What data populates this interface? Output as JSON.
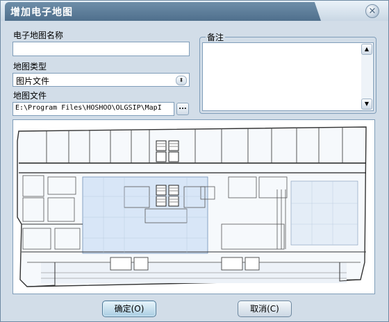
{
  "window": {
    "title": "增加电子地图"
  },
  "form": {
    "map_name_label": "电子地图名称",
    "map_name_value": "",
    "map_type_label": "地图类型",
    "map_type_value": "图片文件",
    "map_file_label": "地图文件",
    "map_file_value": "E:\\Program Files\\HOSHOO\\OLGSIP\\MapI",
    "browse_label": "...",
    "notes_label": "备注",
    "notes_value": ""
  },
  "buttons": {
    "ok_label": "确定(O)",
    "cancel_label": "取消(C)"
  },
  "icons": {
    "close": "close-icon",
    "dropdown": "updown-arrow-icon",
    "scroll_up": "scroll-up-icon",
    "scroll_down": "scroll-down-icon"
  },
  "colors": {
    "title_bar": "#5a7b98",
    "dialog_bg": "#d2dde8",
    "default_button": "#a9cde2",
    "map_highlight": "#d8e6f7"
  }
}
